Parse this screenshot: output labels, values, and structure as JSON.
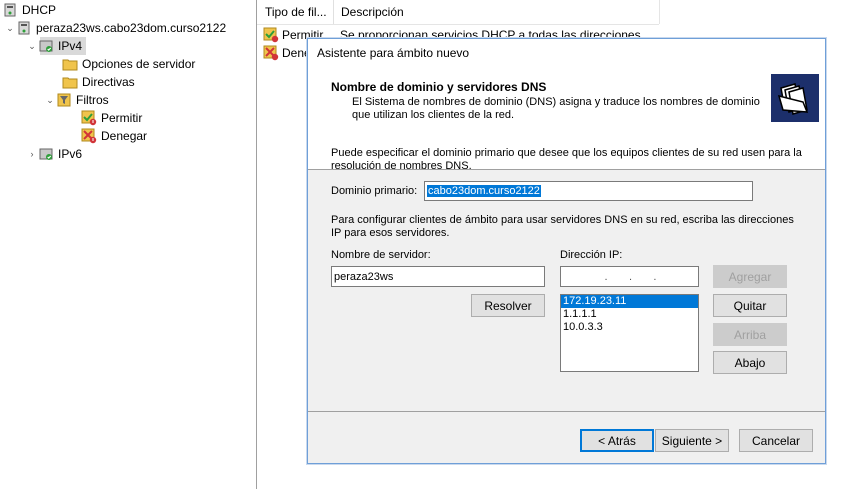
{
  "tree": {
    "root": "DHCP",
    "server": "peraza23ws.cabo23dom.curso2122",
    "ipv4": "IPv4",
    "server_options": "Opciones de servidor",
    "policies": "Directivas",
    "filters": "Filtros",
    "allow": "Permitir",
    "deny": "Denegar",
    "ipv6": "IPv6"
  },
  "list": {
    "col_type": "Tipo de fil...",
    "col_desc": "Descripción",
    "row1_type": "Permitir",
    "row1_desc": "Se proporcionan servicios DHCP a todas las direcciones",
    "row2_type": "Dene"
  },
  "dialog": {
    "title": "Asistente para ámbito nuevo",
    "header_title": "Nombre de dominio y servidores DNS",
    "header_desc": "El Sistema de nombres de dominio (DNS) asigna y traduce los nombres de dominio que utilizan los clientes de la red.",
    "intro_line1": "Puede especificar el dominio primario que desee que los equipos clientes de su red usen para la",
    "intro_line2": "resolución de nombres DNS.",
    "domain_label": "Dominio primario:",
    "domain_value": "cabo23dom.curso2122",
    "config_line1": "Para configurar clientes de ámbito para usar servidores DNS en su red, escriba las direcciones",
    "config_line2": "IP para esos servidores.",
    "server_name_label": "Nombre de servidor:",
    "server_name_value": "peraza23ws",
    "ip_label": "Dirección IP:",
    "ip_placeholder": ".       .       .",
    "ip_list": [
      "172.19.23.11",
      "1.1.1.1",
      "10.0.3.3"
    ],
    "buttons": {
      "resolve": "Resolver",
      "add": "Agregar",
      "remove": "Quitar",
      "up": "Arriba",
      "down": "Abajo",
      "back": "< Atrás",
      "next": "Siguiente >",
      "cancel": "Cancelar"
    }
  },
  "colors": {
    "selection": "#0078d7",
    "dialog_bg": "#f0f0f0",
    "wizard_icon_bg": "#1c2f6b",
    "deny_red": "#d13438",
    "allow_green": "#2e9e3a"
  }
}
